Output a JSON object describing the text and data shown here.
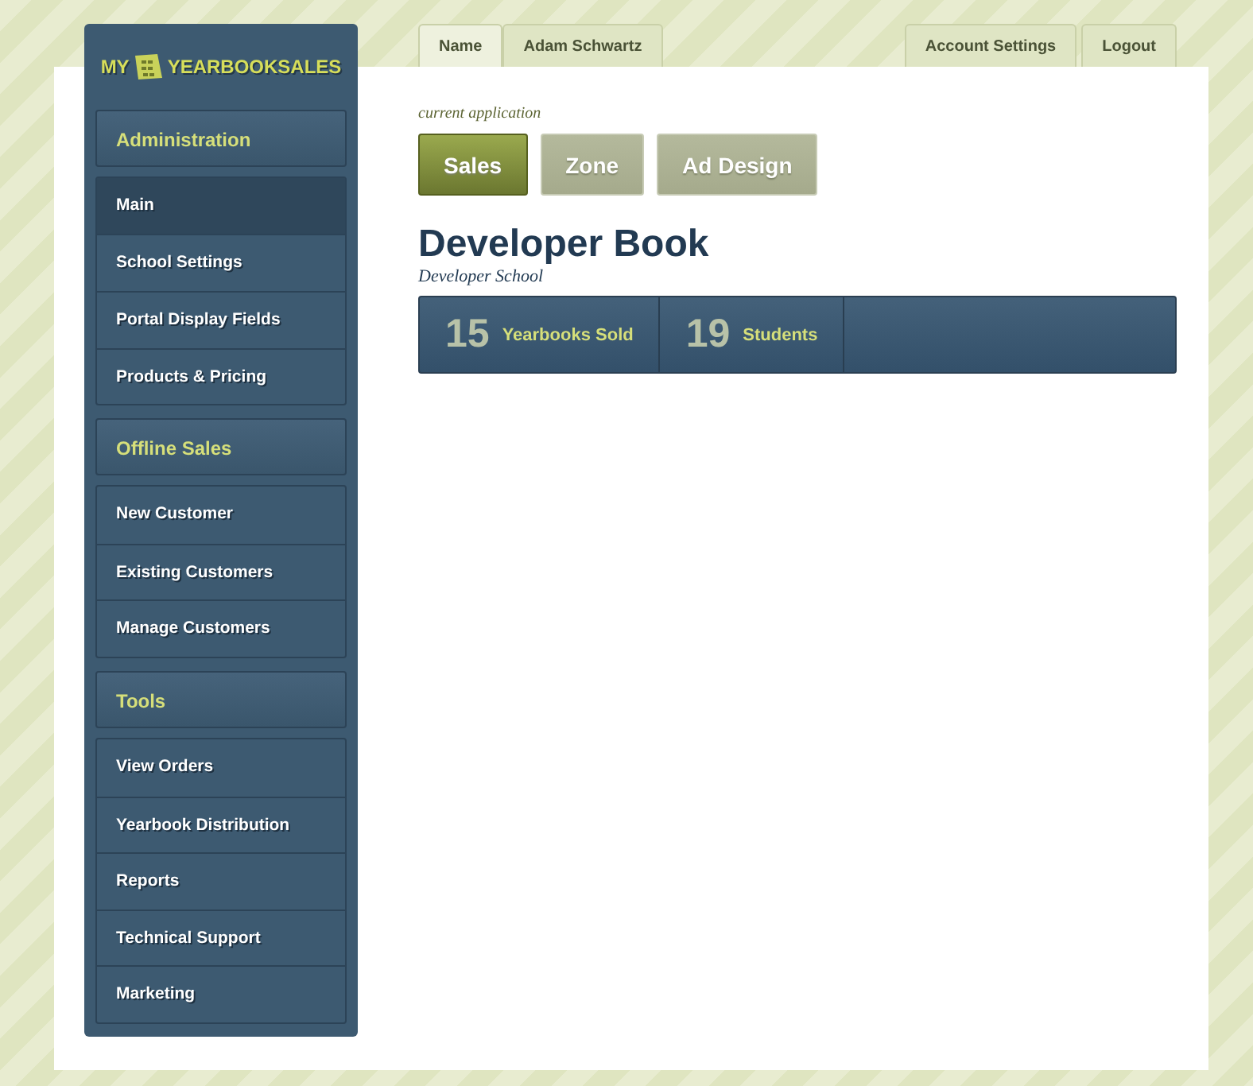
{
  "logo": {
    "left": "MY",
    "right": "YEARBOOKSALES"
  },
  "sidebar": {
    "sections": [
      {
        "title": "Administration",
        "items": [
          {
            "label": "Main",
            "selected": true
          },
          {
            "label": "School Settings",
            "selected": false
          },
          {
            "label": "Portal Display Fields",
            "selected": false
          },
          {
            "label": "Products & Pricing",
            "selected": false
          }
        ]
      },
      {
        "title": "Offline Sales",
        "items": [
          {
            "label": "New Customer",
            "selected": false
          },
          {
            "label": "Existing Customers",
            "selected": false
          },
          {
            "label": "Manage Customers",
            "selected": false
          }
        ]
      },
      {
        "title": "Tools",
        "items": [
          {
            "label": "View Orders",
            "selected": false
          },
          {
            "label": "Yearbook Distribution",
            "selected": false
          },
          {
            "label": "Reports",
            "selected": false
          },
          {
            "label": "Technical Support",
            "selected": false
          },
          {
            "label": "Marketing",
            "selected": false
          }
        ]
      }
    ]
  },
  "user_tabs": [
    {
      "label": "Name",
      "selected": true
    },
    {
      "label": "Adam Schwartz",
      "selected": false
    }
  ],
  "account_tabs": [
    {
      "label": "Account Settings"
    },
    {
      "label": "Logout"
    }
  ],
  "app_label": "current application",
  "apps": [
    {
      "label": "Sales",
      "selected": true
    },
    {
      "label": "Zone",
      "selected": false
    },
    {
      "label": "Ad Design",
      "selected": false
    }
  ],
  "book": {
    "title": "Developer Book",
    "school": "Developer School"
  },
  "stats": [
    {
      "value": "15",
      "label": "Yearbooks Sold"
    },
    {
      "value": "19",
      "label": "Students"
    }
  ]
}
